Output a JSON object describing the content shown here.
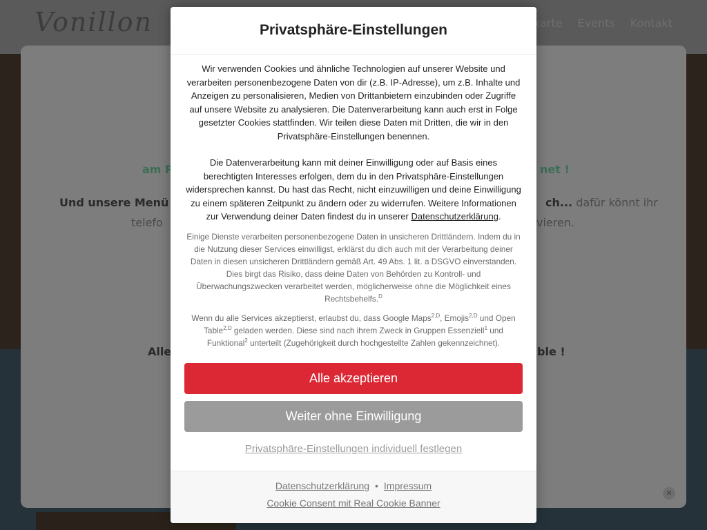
{
  "background": {
    "logo": "Vonillon",
    "nav": [
      "Speisekarte",
      "Events",
      "Kontakt"
    ],
    "panel_line1_left": "am P",
    "panel_line1_right": "net !",
    "panel_line2_left_bold": "Und unsere Menü -",
    "panel_line2_right_bold": "ch...",
    "panel_line2_right": " dafür könnt ihr",
    "panel_line3_left": "telefo",
    "panel_line3_right": "vieren.",
    "panel_line4_left": "Alle",
    "panel_line4_right": "ble !",
    "close_glyph": "✕"
  },
  "dialog": {
    "title": "Privatsphäre-Einstellungen",
    "paragraph1": "Wir verwenden Cookies und ähnliche Technologien auf unserer Website und verarbeiten personenbezogene Daten von dir (z.B. IP-Adresse), um z.B. Inhalte und Anzeigen zu personalisieren, Medien von Drittanbietern einzubinden oder Zugriffe auf unsere Website zu analysieren. Die Datenverarbeitung kann auch erst in Folge gesetzter Cookies stattfinden. Wir teilen diese Daten mit Dritten, die wir in den Privatsphäre-Einstellungen benennen.",
    "paragraph2": "Die Datenverarbeitung kann mit deiner Einwilligung oder auf Basis eines berechtigten Interesses erfolgen, dem du in den Privatsphäre-Einstellungen widersprechen kannst. Du hast das Recht, nicht einzuwilligen und deine Einwilligung zu einem späteren Zeitpunkt zu ändern oder zu widerrufen. Weitere Informationen zur Verwendung deiner Daten findest du in unserer ",
    "paragraph2_link": "Datenschutzerklärung",
    "paragraph2_end": ".",
    "paragraph3": "Einige Dienste verarbeiten personenbezogene Daten in unsicheren Drittländern. Indem du in die Nutzung dieser Services einwilligst, erklärst du dich auch mit der Verarbeitung deiner Daten in diesen unsicheren Drittländern gemäß Art. 49 Abs. 1 lit. a DSGVO einverstanden. Dies birgt das Risiko, dass deine Daten von Behörden zu Kontroll- und Überwachungszwecken verarbeitet werden, möglicherweise ohne die Möglichkeit eines Rechtsbehelfs.",
    "paragraph3_sup": "D",
    "p4_a": "Wenn du alle Services akzeptierst, erlaubst du, dass Google Maps",
    "p4_sup1": "2,D",
    "p4_b": ", Emojis",
    "p4_sup2": "2,D",
    "p4_c": " und Open Table",
    "p4_sup3": "2,D",
    "p4_d": " geladen werden. Diese sind nach ihrem Zweck in Gruppen Essenziell",
    "p4_sup4": "1",
    "p4_e": " und Funktional",
    "p4_sup5": "2",
    "p4_f": " unterteilt (Zugehörigkeit durch hochgestellte Zahlen gekennzeichnet).",
    "accept_label": "Alle akzeptieren",
    "reject_label": "Weiter ohne Einwilligung",
    "individual_label": "Privatsphäre-Einstellungen individuell festlegen",
    "footer_privacy": "Datenschutzerklärung",
    "footer_separator": "•",
    "footer_imprint": "Impressum",
    "footer_credit": "Cookie Consent mit Real Cookie Banner",
    "colors": {
      "accept": "#dc2834",
      "reject": "#9b9b9b"
    }
  }
}
